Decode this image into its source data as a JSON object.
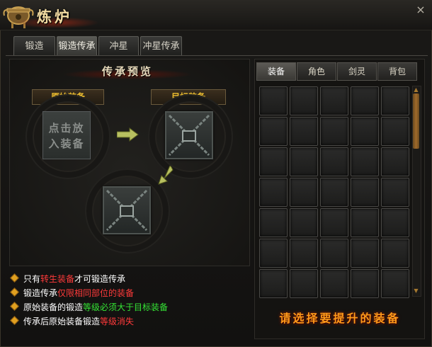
{
  "window": {
    "title": "炼炉",
    "close_label": "×"
  },
  "tabs": [
    {
      "label": "锻造",
      "active": false
    },
    {
      "label": "锻造传承",
      "active": true
    },
    {
      "label": "冲星",
      "active": false
    },
    {
      "label": "冲星传承",
      "active": false
    }
  ],
  "preview": {
    "title": "传承预览",
    "source_label": "原始装备",
    "target_label": "目标装备",
    "placeholder_text": "点击放入装备"
  },
  "notes": [
    {
      "parts": [
        {
          "text": "只有",
          "color": "white"
        },
        {
          "text": "转生装备",
          "color": "red"
        },
        {
          "text": "才可锻造传承",
          "color": "white"
        }
      ]
    },
    {
      "parts": [
        {
          "text": "锻造传承",
          "color": "white"
        },
        {
          "text": "仅限相同部位的装备",
          "color": "red"
        }
      ]
    },
    {
      "parts": [
        {
          "text": "原始装备的锻造",
          "color": "white"
        },
        {
          "text": "等级必须大于目标装备",
          "color": "green"
        }
      ]
    },
    {
      "parts": [
        {
          "text": "传承后原始装备锻造",
          "color": "white"
        },
        {
          "text": "等级消失",
          "color": "red"
        }
      ]
    }
  ],
  "inventory": {
    "tabs": [
      {
        "label": "装备",
        "active": true
      },
      {
        "label": "角色",
        "active": false
      },
      {
        "label": "剑灵",
        "active": false
      },
      {
        "label": "背包",
        "active": false
      }
    ],
    "rows": 7,
    "cols": 5,
    "prompt": "请选择要提升的装备"
  },
  "colors": {
    "accent_gold": "#f0c030",
    "red_text": "#ff3a3a",
    "green_text": "#35e535",
    "prompt_orange": "#ff9a1a"
  }
}
